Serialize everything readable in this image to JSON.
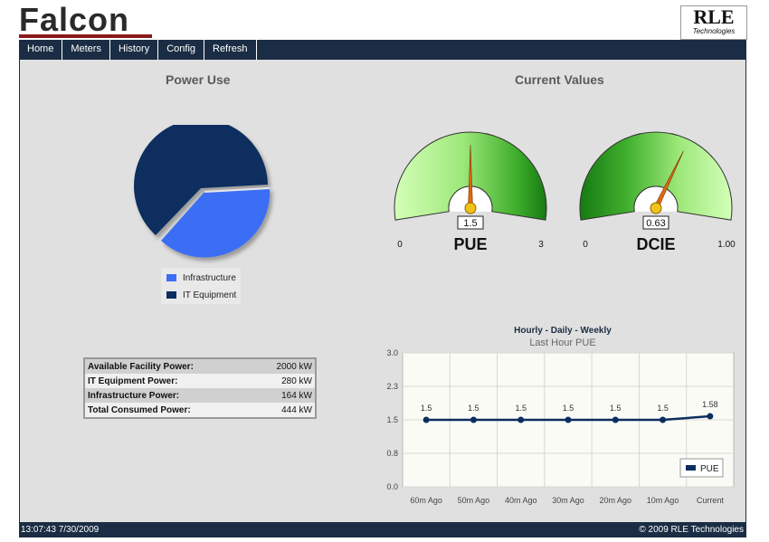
{
  "header": {
    "app_title": "Falcon",
    "brand_logo": "RLE",
    "brand_sub": "Technologies"
  },
  "nav": [
    {
      "label": "Home"
    },
    {
      "label": "Meters"
    },
    {
      "label": "History"
    },
    {
      "label": "Config"
    },
    {
      "label": "Refresh"
    }
  ],
  "power_use": {
    "title": "Power Use",
    "legend": [
      {
        "label": "Infrastructure",
        "color": "#3a6ef5"
      },
      {
        "label": "IT Equipment",
        "color": "#0c2d5f"
      }
    ]
  },
  "stats": [
    {
      "label": "Available Facility Power:",
      "value": "2000 kW"
    },
    {
      "label": "IT Equipment Power:",
      "value": "280 kW"
    },
    {
      "label": "Infrastructure Power:",
      "value": "164 kW"
    },
    {
      "label": "Total Consumed Power:",
      "value": "444 kW"
    }
  ],
  "current_values": {
    "title": "Current Values",
    "gauges": [
      {
        "name": "PUE",
        "value": 1.5,
        "display": "1.5",
        "min": 0,
        "max": 3,
        "min_label": "0",
        "max_label": "3"
      },
      {
        "name": "DCIE",
        "value": 0.63,
        "display": "0.63",
        "min": 0,
        "max": 1.0,
        "min_label": "0",
        "max_label": "1.00"
      }
    ]
  },
  "chart_data": {
    "type": "line",
    "title": "Hourly - Daily - Weekly",
    "subtitle": "Last Hour PUE",
    "categories": [
      "60m Ago",
      "50m Ago",
      "40m Ago",
      "30m Ago",
      "20m Ago",
      "10m Ago",
      "Current"
    ],
    "series": [
      {
        "name": "PUE",
        "values": [
          1.5,
          1.5,
          1.5,
          1.5,
          1.5,
          1.5,
          1.58
        ],
        "labels": [
          "1.5",
          "1.5",
          "1.5",
          "1.5",
          "1.5",
          "1.5",
          "1.58"
        ],
        "color": "#0c2d5f"
      }
    ],
    "yticks": [
      "0.0",
      "0.8",
      "1.5",
      "2.3",
      "3.0"
    ],
    "ylim": [
      0,
      3.0
    ],
    "grid": true,
    "legend_position": "bottom-right"
  },
  "footer": {
    "timestamp": "13:07:43 7/30/2009",
    "copyright": "© 2009 RLE Technologies"
  }
}
